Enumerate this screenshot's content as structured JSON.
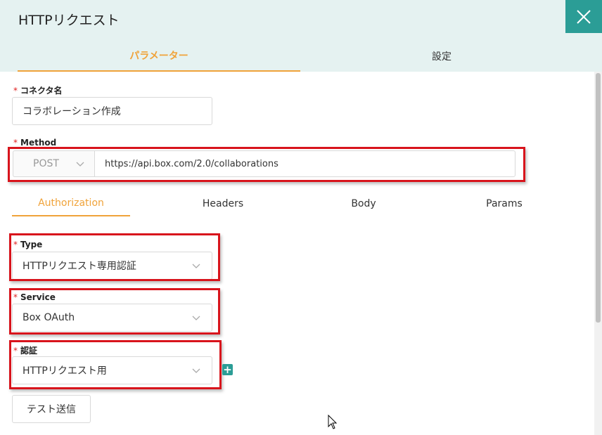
{
  "dialog": {
    "title": "HTTPリクエスト"
  },
  "main_tabs": [
    {
      "label": "パラメーター",
      "active": true
    },
    {
      "label": "設定",
      "active": false
    }
  ],
  "form": {
    "connector_name": {
      "label": "コネクタ名",
      "value": "コラボレーション作成"
    },
    "method": {
      "label": "Method",
      "selected": "POST",
      "url": "https://api.box.com/2.0/collaborations"
    },
    "sub_tabs": [
      {
        "label": "Authorization",
        "active": true
      },
      {
        "label": "Headers",
        "active": false
      },
      {
        "label": "Body",
        "active": false
      },
      {
        "label": "Params",
        "active": false
      }
    ],
    "type": {
      "label": "Type",
      "value": "HTTPリクエスト専用認証"
    },
    "service": {
      "label": "Service",
      "value": "Box OAuth"
    },
    "auth": {
      "label": "認証",
      "value": "HTTPリクエスト用"
    },
    "required_mark": "*",
    "add_label": "+",
    "test_button": "テスト送信"
  },
  "colors": {
    "accent": "#f0a33a",
    "teal": "#2b9d96",
    "highlight_red": "#d8141c",
    "header_bg": "#e5f2f1"
  },
  "icons": [
    "close-icon",
    "chevron-down-icon",
    "plus-icon",
    "mouse-cursor-icon"
  ]
}
